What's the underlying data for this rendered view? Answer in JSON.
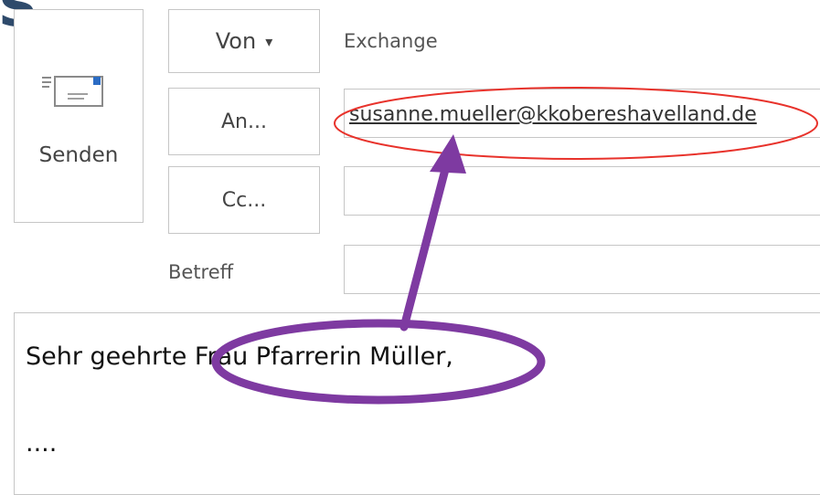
{
  "corner_glyph": "S",
  "toolbar": {
    "send_label": "Senden",
    "send_icon": "send-envelope-icon"
  },
  "header": {
    "from_button_label": "Von",
    "from_button_caret": "▾",
    "from_account": "Exchange",
    "to_button_label": "An...",
    "cc_button_label": "Cc...",
    "subject_label": "Betreff"
  },
  "fields": {
    "to_value": "susanne.mueller@kkobereshavelland.de",
    "cc_value": "",
    "subject_value": ""
  },
  "message": {
    "greeting": "Sehr geehrte Frau Pfarrerin Müller,",
    "continuation": "...."
  },
  "annotations": {
    "email_highlight_color": "#e8322b",
    "name_highlight_color": "#7e3aa1",
    "arrow_color": "#7e3aa1"
  }
}
